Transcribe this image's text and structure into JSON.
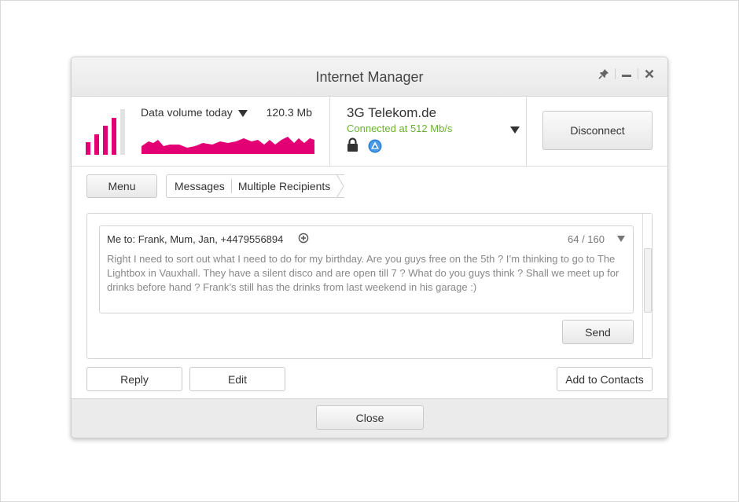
{
  "window": {
    "title": "Internet Manager",
    "controls": [
      "pin-icon",
      "minimize-icon",
      "close-icon"
    ]
  },
  "data_volume": {
    "label": "Data volume today",
    "value": "120.3 Mb",
    "signal_level": 4,
    "signal_total": 5,
    "accent_color": "#e20074"
  },
  "connection": {
    "name": "3G Telekom.de",
    "status": "Connected at 512 Mb/s",
    "status_color": "#6ab32e",
    "icons": [
      "lock-icon",
      "roaming-icon"
    ],
    "disconnect_label": "Disconnect"
  },
  "toolbar": {
    "menu_label": "Menu",
    "breadcrumb": [
      "Messages",
      "Multiple Recipients"
    ]
  },
  "message": {
    "recipients": "Me to: Frank, Mum, Jan, +4479556894",
    "char_count": "64 / 160",
    "body": "Right I need to sort out what I need to do for my birthday. Are you guys free on the 5th ? I’m thinking to go to The Lightbox in Vauxhall. They have a silent disco and are open till 7 ? What do you guys think ? Shall we meet up for drinks before hand ? Frank’s still has the drinks from last weekend in his garage :)",
    "send_label": "Send"
  },
  "actions": {
    "reply_label": "Reply",
    "edit_label": "Edit",
    "add_contacts_label": "Add to Contacts"
  },
  "footer": {
    "close_label": "Close"
  }
}
